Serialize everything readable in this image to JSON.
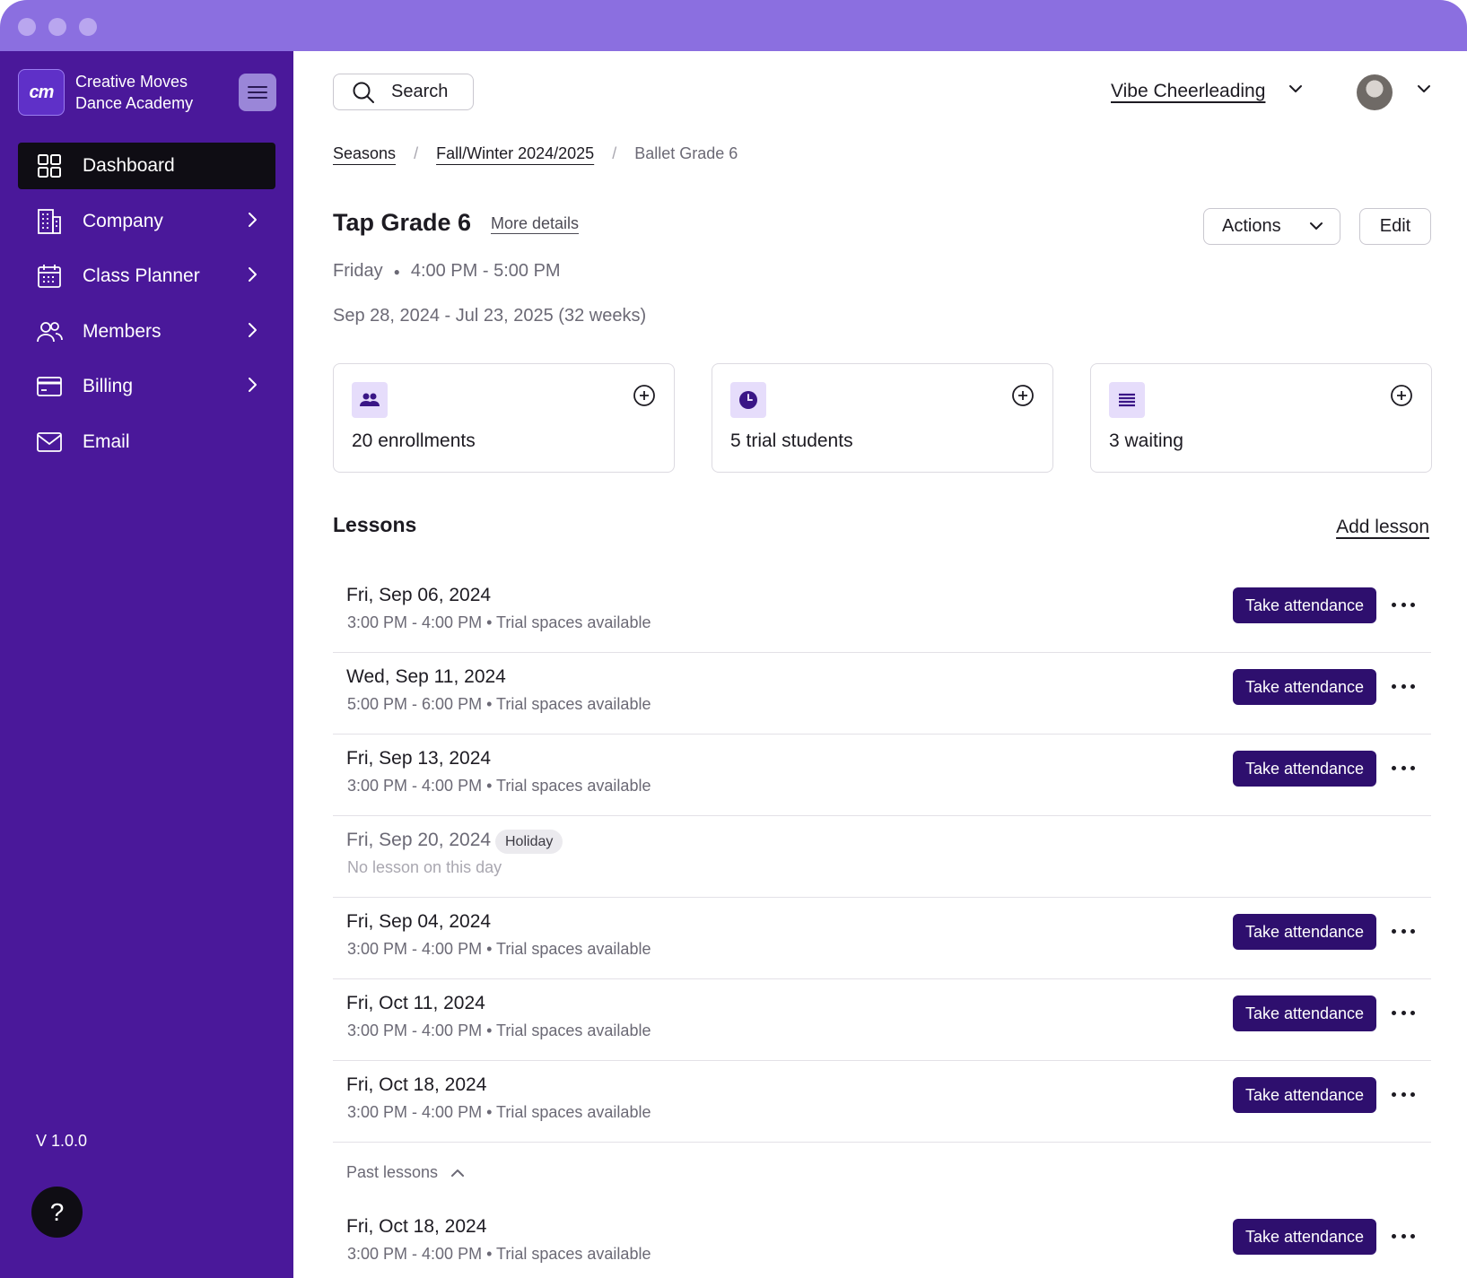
{
  "brand": {
    "logo_text": "cm",
    "name_line1": "Creative Moves",
    "name_line2": "Dance Academy"
  },
  "sidebar": {
    "items": [
      {
        "label": "Dashboard",
        "icon": "grid-icon",
        "active": true
      },
      {
        "label": "Company",
        "icon": "building-icon"
      },
      {
        "label": "Class Planner",
        "icon": "calendar-icon"
      },
      {
        "label": "Members",
        "icon": "users-icon"
      },
      {
        "label": "Billing",
        "icon": "credit-card-icon"
      },
      {
        "label": "Email",
        "icon": "mail-icon"
      }
    ],
    "version": "V 1.0.0",
    "help_label": "?"
  },
  "header": {
    "search_label": "Search",
    "org_name": "Vibe Cheerleading"
  },
  "breadcrumb": [
    "Seasons",
    "Fall/Winter 2024/2025",
    "Ballet Grade 6"
  ],
  "class": {
    "title": "Tap Grade 6",
    "more_details": "More details",
    "actions_label": "Actions",
    "edit_label": "Edit",
    "day": "Friday",
    "time": "4:00 PM - 5:00 PM",
    "range": "Sep 28, 2024 - Jul 23, 2025 (32 weeks)"
  },
  "stats": [
    {
      "label": "20 enrollments",
      "icon": "users-icon"
    },
    {
      "label": "5 trial students",
      "icon": "clock-icon"
    },
    {
      "label": "3 waiting",
      "icon": "list-icon"
    }
  ],
  "lessons": {
    "heading": "Lessons",
    "add_label": "Add lesson",
    "attend_label": "Take attendance",
    "holiday_label": "Holiday",
    "past_label": "Past lessons",
    "rows": [
      {
        "date": "Fri, Sep 06, 2024",
        "sub": "3:00 PM - 4:00 PM • Trial spaces available"
      },
      {
        "date": "Wed, Sep 11, 2024",
        "sub": "5:00 PM - 6:00 PM • Trial spaces available"
      },
      {
        "date": "Fri, Sep 13, 2024",
        "sub": "3:00 PM - 4:00 PM • Trial spaces available"
      },
      {
        "date": "Fri, Sep 20, 2024",
        "sub": "No lesson on this day",
        "holiday": true
      },
      {
        "date": "Fri, Sep 04, 2024",
        "sub": "3:00 PM - 4:00 PM • Trial spaces available"
      },
      {
        "date": "Fri, Oct 11, 2024",
        "sub": "3:00 PM - 4:00 PM • Trial spaces available"
      },
      {
        "date": "Fri, Oct 18, 2024",
        "sub": "3:00 PM - 4:00 PM • Trial spaces available"
      }
    ],
    "past_rows": [
      {
        "date": "Fri, Oct 18, 2024",
        "sub": "3:00 PM - 4:00 PM • Trial spaces available"
      }
    ]
  },
  "colors": {
    "titlebar": "#8b6fe0",
    "sidebar": "#4a189a",
    "accent_button": "#2e0f6e",
    "active_nav": "#0f0d14"
  }
}
